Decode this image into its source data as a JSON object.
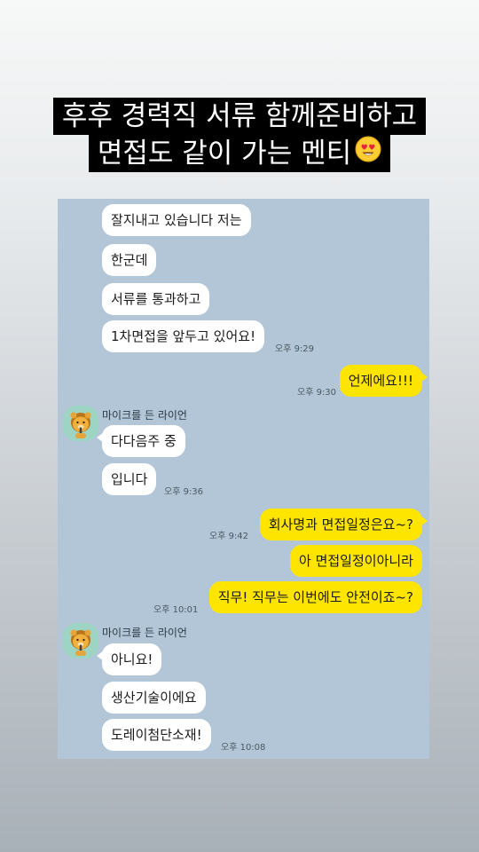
{
  "caption": {
    "line1": "후후 경력직 서류 함께준비하고",
    "line2": "면접도 같이 가는 멘티",
    "emoji_icon": "smiling-face-heart-eyes-icon"
  },
  "chat": {
    "background_color": "#b2c6d7",
    "outgoing_color": "#fee500",
    "sender_name": "마이크를 든 라이언",
    "messages": [
      {
        "text": "잘지내고 있습니다 저는"
      },
      {
        "text": "한군데"
      },
      {
        "text": "서류를 통과하고"
      },
      {
        "text": "1차면접을 앞두고 있어요!",
        "time": "오후 9:29"
      },
      {
        "text": "언제에요!!!",
        "time": "오후 9:30"
      },
      {
        "text": "다다음주 중"
      },
      {
        "text": "입니다",
        "time": "오후 9:36"
      },
      {
        "text": "회사명과 면접일정은요~?",
        "time": "오후 9:42"
      },
      {
        "text": "아 면접일정이아니라"
      },
      {
        "text": "직무! 직무는 이번에도 안전이죠~?",
        "time": "오후 10:01"
      },
      {
        "text": "아니요!"
      },
      {
        "text": "생산기술이에요"
      },
      {
        "text": "도레이첨단소재!",
        "time": "오후 10:08"
      }
    ]
  }
}
